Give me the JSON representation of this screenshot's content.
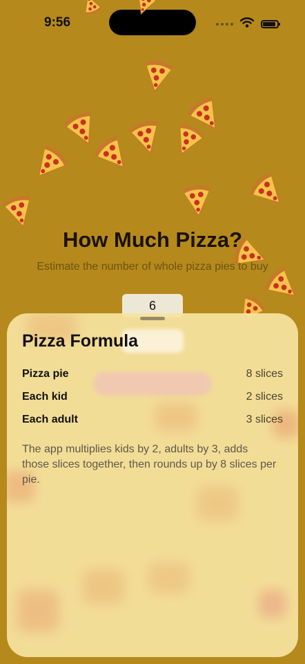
{
  "status_bar": {
    "time": "9:56"
  },
  "header": {
    "title": "How Much Pizza?",
    "subtitle": "Estimate the number of whole pizza pies to buy"
  },
  "stepper": {
    "value": "6"
  },
  "sheet": {
    "title": "Pizza Formula",
    "rows": [
      {
        "label": "Pizza pie",
        "value": "8 slices"
      },
      {
        "label": "Each kid",
        "value": "2 slices"
      },
      {
        "label": "Each adult",
        "value": "3 slices"
      }
    ],
    "description": "The app multiplies kids by 2, adults by 3, adds those slices together, then rounds up by 8 slices per pie."
  },
  "colors": {
    "background": "#b5891c",
    "sheet": "#f6e3a0",
    "crust": "#c8782a",
    "cheese": "#f7c34a",
    "pepperoni": "#c8321e"
  },
  "icons": [
    "wifi-icon",
    "battery-icon",
    "pizza-slice-icon"
  ]
}
